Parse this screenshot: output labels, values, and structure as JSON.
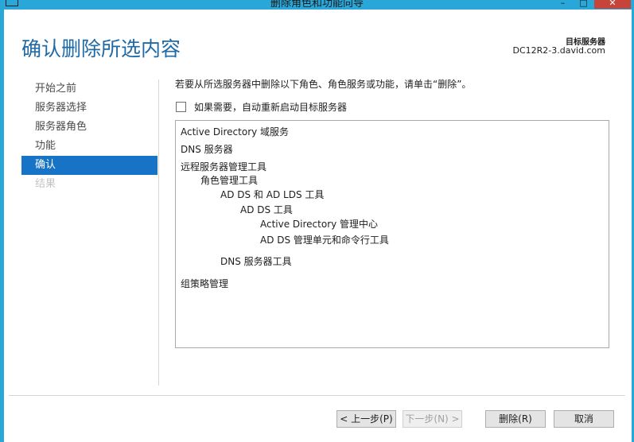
{
  "window": {
    "title": "删除角色和功能向导"
  },
  "header": {
    "page_title": "确认删除所选内容",
    "target_server_label": "目标服务器",
    "target_server_name": "DC12R2-3.david.com"
  },
  "nav": {
    "items": [
      {
        "label": "开始之前"
      },
      {
        "label": "服务器选择"
      },
      {
        "label": "服务器角色"
      },
      {
        "label": "功能"
      },
      {
        "label": "确认"
      },
      {
        "label": "结果"
      }
    ]
  },
  "content": {
    "instruction": "若要从所选服务器中删除以下角色、角色服务或功能，请单击“删除”。",
    "restart_checkbox_label": "如果需要，自动重新启动目标服务器",
    "restart_checked": false,
    "items": [
      {
        "text": "Active Directory 域服务",
        "level": 0
      },
      {
        "text": "DNS 服务器",
        "level": 0
      },
      {
        "text": "远程服务器管理工具",
        "level": 0
      },
      {
        "text": "角色管理工具",
        "level": 1
      },
      {
        "text": "AD DS 和 AD LDS 工具",
        "level": 2
      },
      {
        "text": "AD DS 工具",
        "level": 3
      },
      {
        "text": "Active Directory 管理中心",
        "level": 4
      },
      {
        "text": "AD DS 管理单元和命令行工具",
        "level": 4
      },
      {
        "text": "DNS 服务器工具",
        "level": 2
      },
      {
        "text": "组策略管理",
        "level": 0
      }
    ]
  },
  "buttons": {
    "prev": "< 上一步(P)",
    "next": "下一步(N) >",
    "remove": "删除(R)",
    "cancel": "取消"
  },
  "colors": {
    "accent": "#1673c5",
    "title": "#1f6aa6",
    "titlebar": "#29a7d8"
  }
}
